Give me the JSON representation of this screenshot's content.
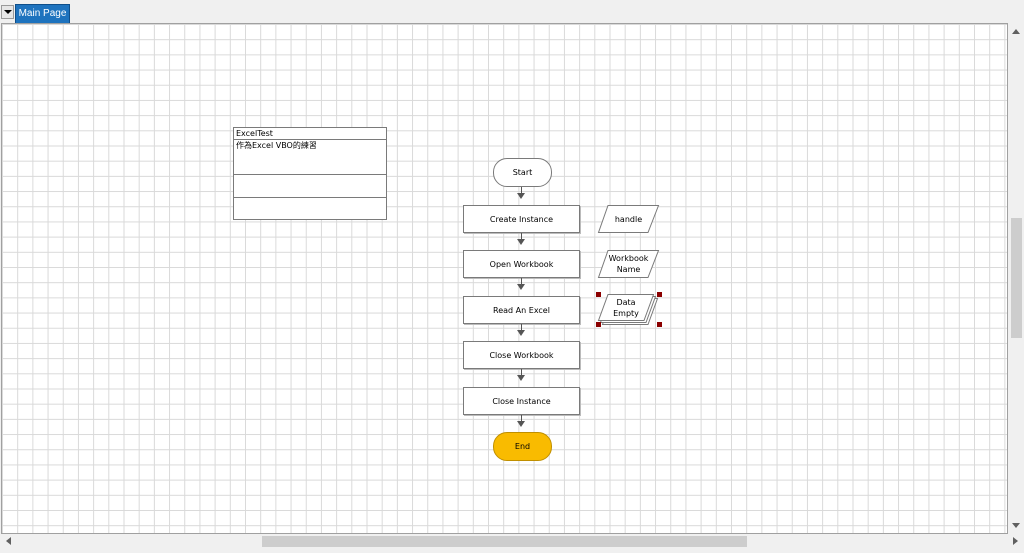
{
  "tabs": {
    "dropdown_icon": "chevron-down-icon",
    "items": [
      {
        "label": "Main Page",
        "active": true
      }
    ]
  },
  "info_box": {
    "title": "ExcelTest",
    "description": "作為Excel VBO的練習"
  },
  "flow": {
    "start_label": "Start",
    "end_label": "End",
    "steps": [
      "Create Instance",
      "Open Workbook",
      "Read An Excel",
      "Close Workbook",
      "Close Instance"
    ]
  },
  "data_items": [
    {
      "label": "handle",
      "type": "data"
    },
    {
      "label": "Workbook Name",
      "line1": "Workbook",
      "line2": "Name",
      "type": "data"
    },
    {
      "label": "Data Empty",
      "line1": "Data",
      "line2": "Empty",
      "type": "collection",
      "selected": true
    }
  ],
  "colors": {
    "tab_active": "#1e73be",
    "end_stage": "#f9bb00",
    "grid": "#d9d9d9",
    "selection_handle": "#8b0000"
  }
}
